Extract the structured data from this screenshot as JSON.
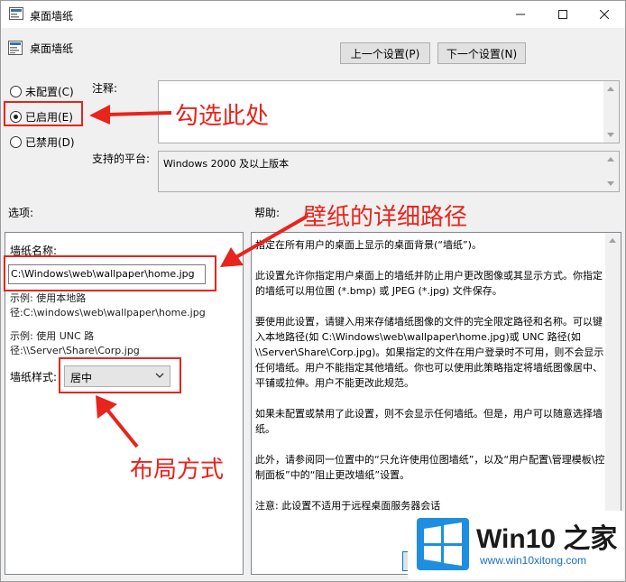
{
  "window": {
    "title": "桌面墙纸"
  },
  "header": {
    "title": "桌面墙纸"
  },
  "nav": {
    "prev_label": "上一个设置(P)",
    "next_label": "下一个设置(N)"
  },
  "state": {
    "options": [
      {
        "label": "未配置(C)",
        "selected": false
      },
      {
        "label": "已启用(E)",
        "selected": true
      },
      {
        "label": "已禁用(D)",
        "selected": false
      }
    ]
  },
  "comment": {
    "label": "注释:",
    "value": ""
  },
  "platform": {
    "label": "支持的平台:",
    "value": "Windows 2000 及以上版本"
  },
  "options_section": {
    "label": "选项:",
    "wallpaper_name_label": "墙纸名称:",
    "wallpaper_path": "C:\\Windows\\web\\wallpaper\\home.jpg",
    "example1_line1": "示例: 使用本地路",
    "example1_line2": "径:C:\\windows\\web\\wallpaper\\home.jpg",
    "example2_line1": "示例: 使用 UNC 路",
    "example2_line2": "径:\\\\Server\\Share\\Corp.jpg",
    "style_label": "墙纸样式:",
    "style_value": "居中"
  },
  "help_section": {
    "label": "帮助:",
    "paragraphs": [
      "指定在所有用户的桌面上显示的桌面背景(“墙纸”)。",
      "此设置允许你指定用户桌面上的墙纸并防止用户更改图像或其显示方式。你指定的墙纸可以用位图 (*.bmp) 或 JPEG (*.jpg) 文件保存。",
      "要使用此设置，请键入用来存储墙纸图像的文件的完全限定路径和名称。可以键入本地路径(如 C:\\Windows\\web\\wallpaper\\home.jpg)或 UNC 路径(如 \\\\Server\\Share\\Corp.jpg)。如果指定的文件在用户登录时不可用，则不会显示任何墙纸。用户不能指定其他墙纸。你也可以使用此策略指定将墙纸图像居中、平铺或拉伸。用户不能更改此规范。",
      "如果未配置或禁用了此设置，则不会显示任何墙纸。但是，用户可以随意选择墙纸。",
      "此外，请参阅同一位置中的“只允许使用位图墙纸”，以及“用户配置\\管理模板\\控制面板”中的“阻止更改墙纸”设置。",
      "注意: 此设置不适用于远程桌面服务器会话"
    ]
  },
  "annotations": {
    "enable_hint": "勾选此处",
    "path_hint": "壁纸的详细路径",
    "layout_hint": "布局方式",
    "color": "#e8241c"
  },
  "watermark": {
    "title": "Win10 之家",
    "url": "www.win10xitong.com"
  }
}
